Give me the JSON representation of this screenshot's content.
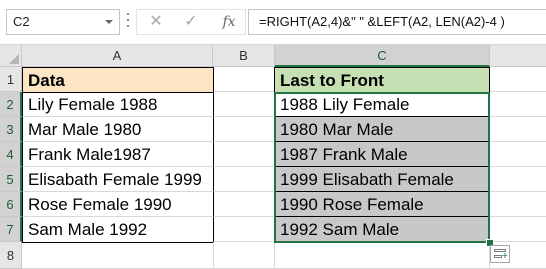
{
  "formula_bar": {
    "name_box": "C2",
    "cancel_glyph": "✕",
    "enter_glyph": "✓",
    "fx_label": "fx",
    "formula": "=RIGHT(A2,4)&\" \" &LEFT(A2, LEN(A2)-4 )"
  },
  "columns": [
    "A",
    "B",
    "C"
  ],
  "rows": [
    "1",
    "2",
    "3",
    "4",
    "5",
    "6",
    "7",
    "8"
  ],
  "selected_column": "C",
  "selected_rows": [
    "2",
    "3",
    "4",
    "5",
    "6",
    "7"
  ],
  "cells": {
    "A1": "Data",
    "C1": "Last to Front",
    "A": [
      "Lily Female 1988",
      "Mar Male 1980",
      "Frank Male1987",
      "Elisabath Female 1999",
      "Rose Female 1990",
      "Sam Male 1992"
    ],
    "C": [
      "1988 Lily Female",
      "1980 Mar Male",
      "1987 Frank Male",
      "1999 Elisabath Female",
      "1990 Rose Female",
      "1992 Sam Male"
    ]
  },
  "colors": {
    "data_header_fill": "#fbe5c3",
    "result_header_fill": "#c6e0b4",
    "selection_fill": "#c8c8c8",
    "selection_border": "#217346"
  },
  "icons": [
    "dropdown-arrow-icon",
    "cancel-icon",
    "enter-icon",
    "function-icon",
    "select-all-icon",
    "quick-analysis-icon"
  ]
}
